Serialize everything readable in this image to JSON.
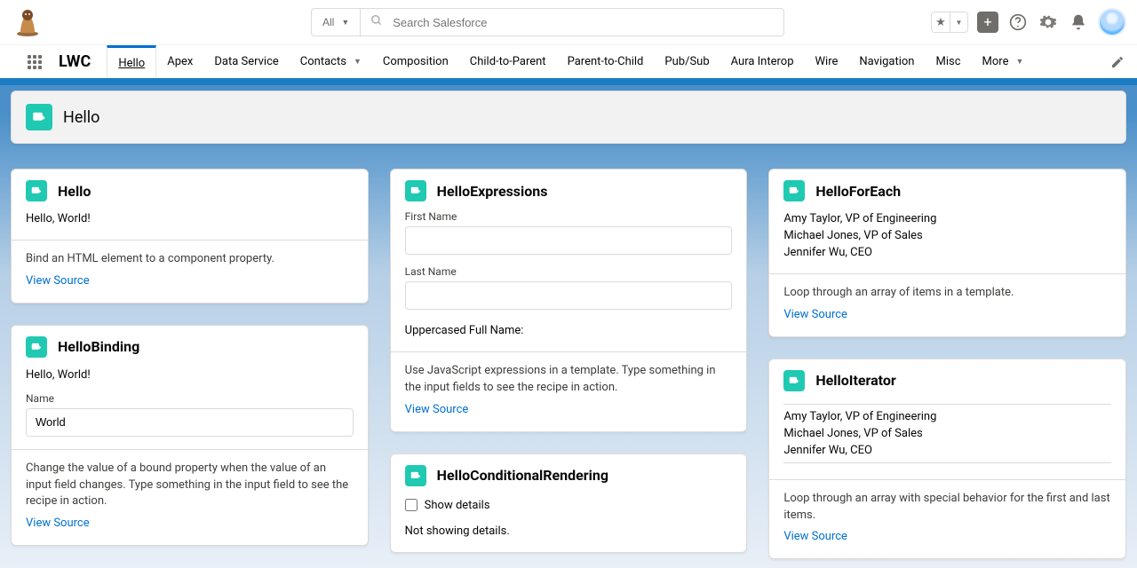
{
  "search": {
    "scope": "All",
    "placeholder": "Search Salesforce"
  },
  "app_name": "LWC",
  "nav": {
    "tabs": [
      "Hello",
      "Apex",
      "Data Service",
      "Contacts",
      "Composition",
      "Child-to-Parent",
      "Parent-to-Child",
      "Pub/Sub",
      "Aura Interop",
      "Wire",
      "Navigation",
      "Misc",
      "More"
    ],
    "active": "Hello",
    "has_dropdown": [
      "Contacts",
      "More"
    ]
  },
  "page_title": "Hello",
  "view_source_label": "View Source",
  "cards": {
    "hello": {
      "title": "Hello",
      "body": "Hello, World!",
      "desc": "Bind an HTML element to a component property."
    },
    "binding": {
      "title": "HelloBinding",
      "greeting": "Hello, World!",
      "name_label": "Name",
      "name_value": "World",
      "desc": "Change the value of a bound property when the value of an input field changes. Type something in the input field to see the recipe in action."
    },
    "expressions": {
      "title": "HelloExpressions",
      "first_label": "First Name",
      "last_label": "Last Name",
      "result_label": "Uppercased Full Name:",
      "desc": "Use JavaScript expressions in a template. Type something in the input fields to see the recipe in action."
    },
    "conditional": {
      "title": "HelloConditionalRendering",
      "checkbox_label": "Show details",
      "status": "Not showing details."
    },
    "foreach": {
      "title": "HelloForEach",
      "items": [
        "Amy Taylor, VP of Engineering",
        "Michael Jones, VP of Sales",
        "Jennifer Wu, CEO"
      ],
      "desc": "Loop through an array of items in a template."
    },
    "iterator": {
      "title": "HelloIterator",
      "items": [
        "Amy Taylor, VP of Engineering",
        "Michael Jones, VP of Sales",
        "Jennifer Wu, CEO"
      ],
      "desc": "Loop through an array with special behavior for the first and last items."
    }
  }
}
